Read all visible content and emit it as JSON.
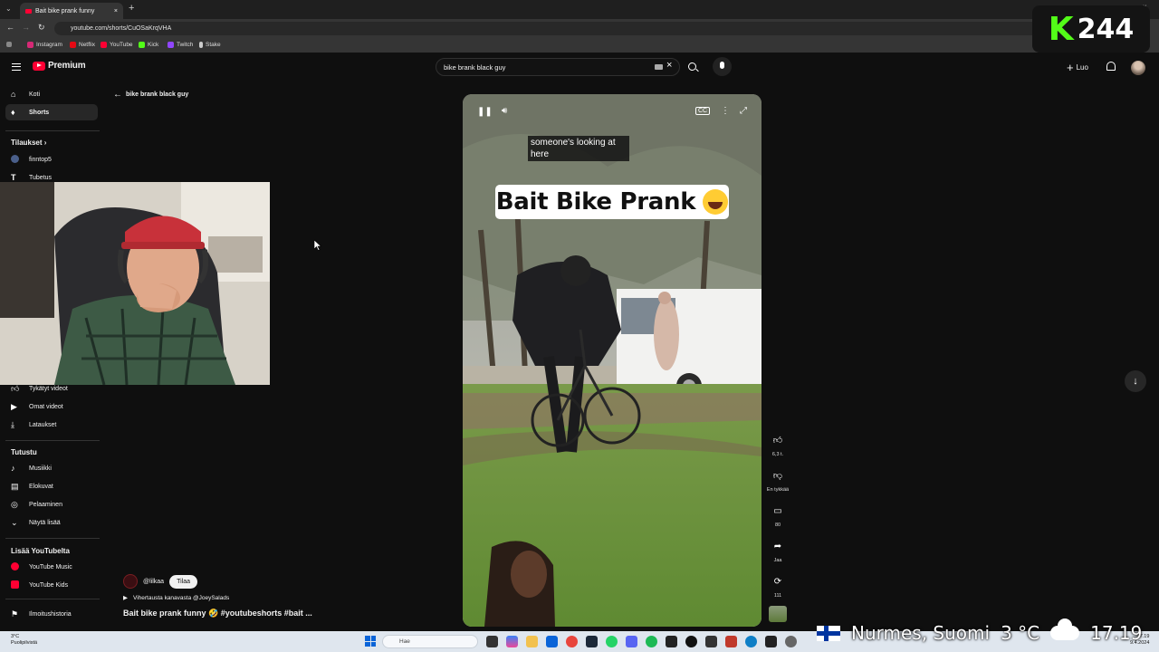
{
  "browser": {
    "tab_title": "Bait bike prank funny",
    "url": "youtube.com/shorts/CuOSaKrqVHA",
    "bookmarks": [
      "Instagram",
      "Netflix",
      "YouTube",
      "Kick",
      "Twitch",
      "Stake"
    ]
  },
  "kick_logo": {
    "letter": "K",
    "number": "244",
    "color": "#53fc18"
  },
  "header": {
    "brand": "Premium",
    "search_value": "bike brank black guy",
    "create_label": "Luo"
  },
  "sidebar": {
    "items": [
      {
        "label": "Koti",
        "icon": "home-icon"
      },
      {
        "label": "Shorts",
        "icon": "shorts-icon",
        "active": true
      }
    ],
    "subs_heading": "Tilaukset",
    "subs": [
      {
        "label": "finntop5"
      },
      {
        "label": "Tubetus"
      }
    ],
    "you_items": [
      {
        "label": "Tykätyt videot",
        "icon": "like-icon"
      },
      {
        "label": "Omat videot",
        "icon": "video-icon"
      },
      {
        "label": "Lataukset",
        "icon": "download-icon"
      }
    ],
    "explore_heading": "Tutustu",
    "explore_items": [
      {
        "label": "Musiikki",
        "icon": "music-icon"
      },
      {
        "label": "Elokuvat",
        "icon": "film-icon"
      },
      {
        "label": "Pelaaminen",
        "icon": "gaming-icon"
      },
      {
        "label": "Näytä lisää",
        "icon": "chevron-down-icon"
      }
    ],
    "more_heading": "Lisää YouTubelta",
    "more_items": [
      {
        "label": "YouTube Music",
        "icon": "yt-music-icon"
      },
      {
        "label": "YouTube Kids",
        "icon": "yt-kids-icon"
      }
    ],
    "report": "Ilmoitushistoria"
  },
  "back_link": "bike brank black guy",
  "video": {
    "caption_line1": "someone's looking at",
    "caption_line2": "here",
    "title_card": "Bait Bike Prank"
  },
  "actions": {
    "likes": "6,3 t.",
    "dislike": "En tykkää",
    "comments": "80",
    "share": "Jaa",
    "remix": "111"
  },
  "channel": {
    "name": "@lilkaa",
    "subscribe": "Tilaa",
    "related": "Vihertausta kanavasta @JoeySalads",
    "short_title": "Bait bike prank funny 🤣 #youtubeshorts #bait ..."
  },
  "taskbar": {
    "weather_temp": "3°C",
    "weather_desc": "Puolipilvistä",
    "search_placeholder": "Hae",
    "clock_time": "17.19",
    "clock_date": "9.4.2024"
  },
  "overlay": {
    "location": "Nurmes, Suomi",
    "temp": "3 °C",
    "time": "17.19"
  }
}
